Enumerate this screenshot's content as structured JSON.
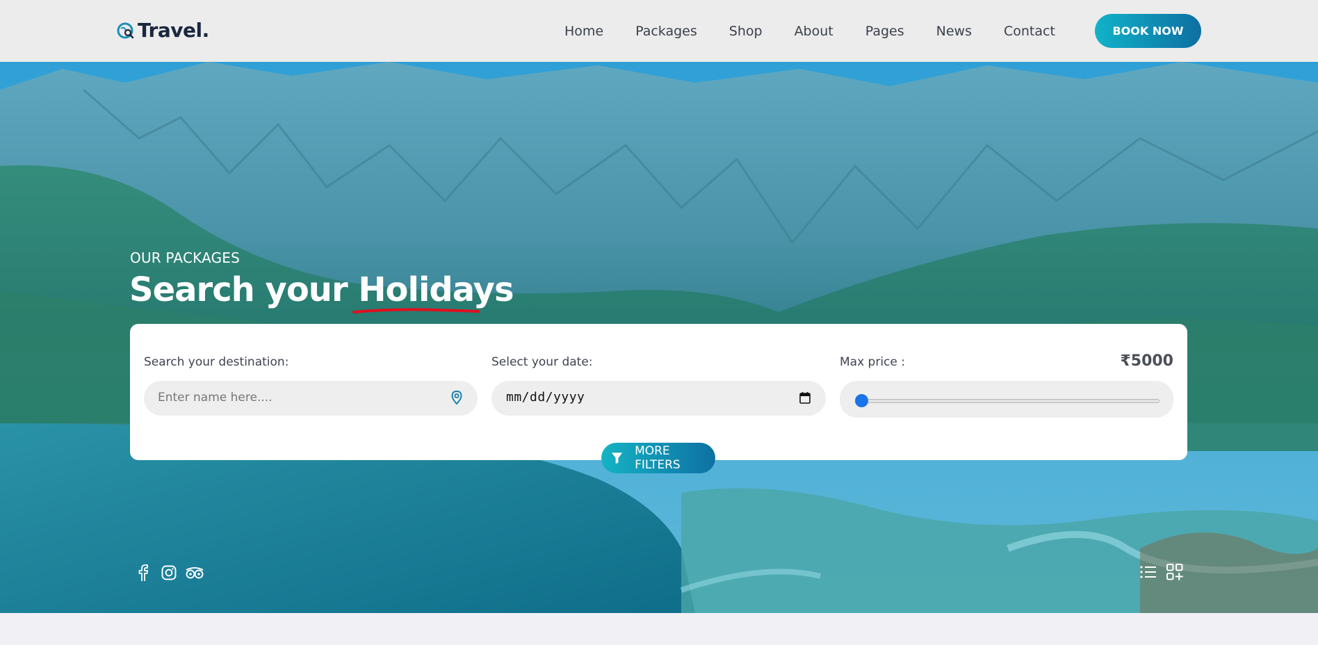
{
  "brand": {
    "name": "Travel."
  },
  "nav": {
    "items": [
      "Home",
      "Packages",
      "Shop",
      "About",
      "Pages",
      "News",
      "Contact"
    ],
    "cta": "BOOK NOW"
  },
  "hero": {
    "eyebrow": "OUR PACKAGES",
    "title_plain": "Search your ",
    "title_highlight": "Holidays"
  },
  "search": {
    "destination": {
      "label": "Search your destination:",
      "placeholder": "Enter name here...."
    },
    "date": {
      "label": "Select your date:",
      "value": "mm/dd/yyyy"
    },
    "price": {
      "label": "Max price :",
      "value": "₹5000",
      "slider_fraction": 0
    },
    "more_filters": "MORE FILTERS"
  },
  "social_icons": [
    "facebook-icon",
    "instagram-icon",
    "tripadvisor-icon"
  ],
  "view_icons": [
    "list-view-icon",
    "grid-view-icon"
  ],
  "colors": {
    "accent_start": "#11b2c9",
    "accent_end": "#0e6fa1",
    "highlight_underline": "#e0101e",
    "slider": "#1a73e8"
  }
}
